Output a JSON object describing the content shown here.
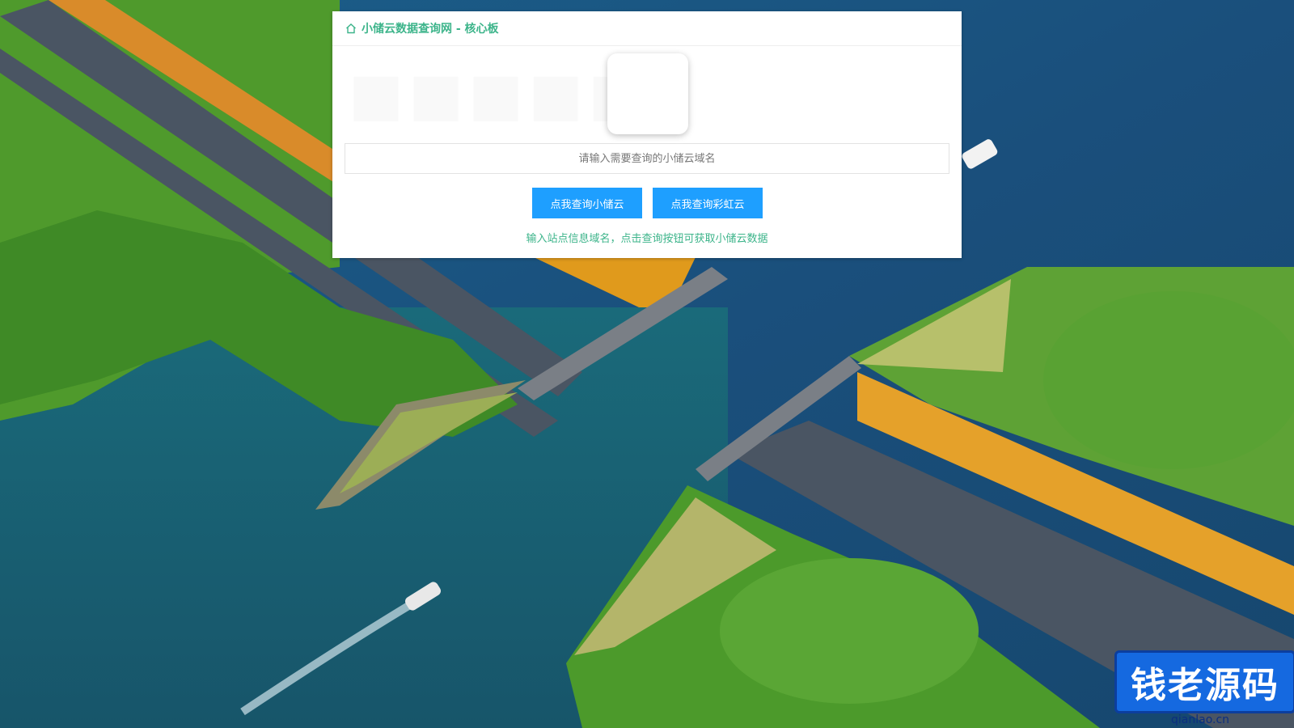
{
  "panel": {
    "title": "小储云数据查询网 - 核心板",
    "home_icon": "home-icon",
    "search_placeholder": "请输入需要查询的小储云域名",
    "buttons": {
      "query_xiaochuyun": "点我查询小储云",
      "query_caihongyun": "点我查询彩虹云"
    },
    "hint": "输入站点信息域名，点击查询按钮可获取小储云数据",
    "accent_color": "#3cb48a",
    "button_color": "#1e9fff"
  },
  "watermark": {
    "text": "钱老源码",
    "domain": "qianlao.cn"
  }
}
